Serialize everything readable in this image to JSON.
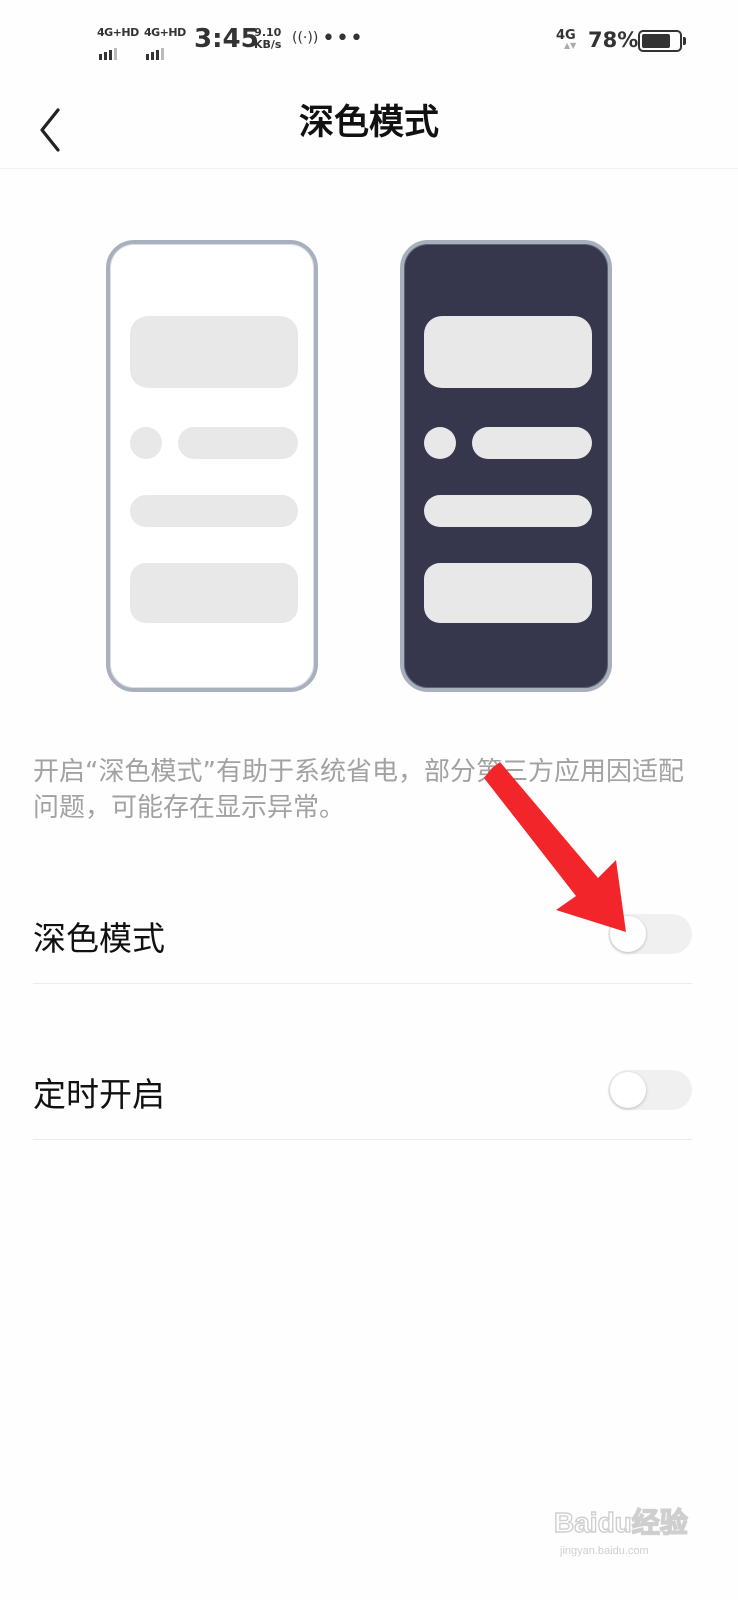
{
  "status_bar": {
    "sim1_network": "4G+HD",
    "sim2_network": "4G+HD",
    "time": "3:45",
    "speed_value": "9.10",
    "speed_unit": "KB/s",
    "hotspot": "((·))",
    "more": "•••",
    "data_network": "4G",
    "battery_percent": "78%",
    "battery_level": 0.78
  },
  "header": {
    "back_icon": "chevron-left-icon",
    "title": "深色模式"
  },
  "preview": {
    "light_phone_color": "#ffffff",
    "dark_phone_color": "#36364c",
    "frame_color": "#a7b0bc",
    "placeholder_color": "#e8e8e8"
  },
  "description": "开启“深色模式”有助于系统省电，部分第三方应用因适配问题，可能存在显示异常。",
  "settings": [
    {
      "label": "深色模式",
      "enabled": false
    },
    {
      "label": "定时开启",
      "enabled": false
    }
  ],
  "annotation": {
    "arrow_color": "#f2262a",
    "arrow_icon": "red-arrow-icon"
  },
  "watermark": {
    "text": "Baidu经验",
    "sub": "jingyan.baidu.com"
  }
}
